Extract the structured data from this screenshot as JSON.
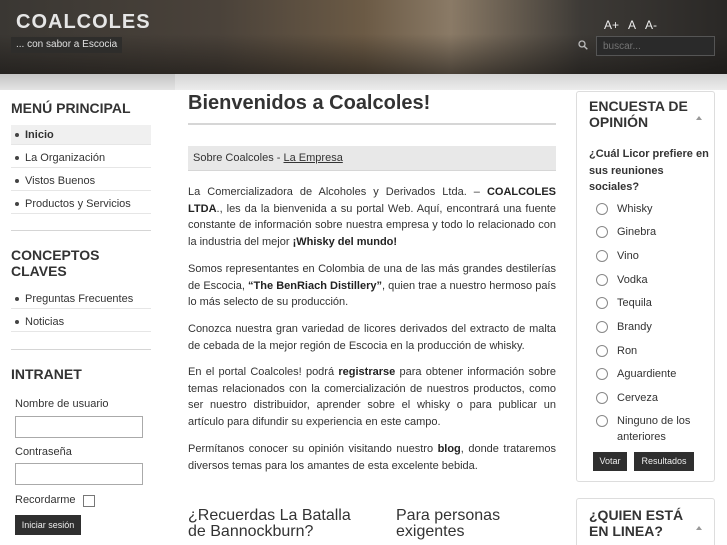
{
  "header": {
    "site_title": "COALCOLES",
    "slogan": "... con sabor a Escocia",
    "font_controls": [
      "A+",
      "A",
      "A-"
    ],
    "search_placeholder": "buscar..."
  },
  "left": {
    "main_menu": {
      "title": "MENÚ PRINCIPAL",
      "items": [
        {
          "label": "Inicio",
          "active": true
        },
        {
          "label": "La Organización"
        },
        {
          "label": "Vistos Buenos"
        },
        {
          "label": "Productos y Servicios"
        }
      ]
    },
    "concepts": {
      "title_line1": "CONCEPTOS",
      "title_line2": "CLAVES",
      "items": [
        {
          "label": "Preguntas Frecuentes"
        },
        {
          "label": "Noticias"
        }
      ]
    },
    "intranet": {
      "title": "INTRANET",
      "username_label": "Nombre de usuario",
      "password_label": "Contraseña",
      "remember_label": "Recordarme",
      "login_button": "Iniciar sesión"
    }
  },
  "main": {
    "title": "Bienvenidos a Coalcoles!",
    "breadcrumb": {
      "prefix": "Sobre Coalcoles - ",
      "link": "La Empresa"
    },
    "p1": {
      "a": "La Comercializadora de Alcoholes y Derivados Ltda. – ",
      "b": "COALCOLES LTDA",
      "c": "., les da la bienvenida a su portal Web. Aquí, encontrará una fuente constante de información sobre nuestra empresa y todo lo relacionado con la industria del mejor ",
      "d": "¡Whisky del mundo!"
    },
    "p2": {
      "a": "Somos representantes en Colombia de una de las más grandes destilerías de Escocia, ",
      "b": "“The BenRiach Distillery”",
      "c": ", quien trae a nuestro hermoso país lo más selecto de su producción."
    },
    "p3": "Conozca nuestra gran variedad de licores derivados del extracto de malta de cebada de la mejor región de Escocia en la producción de whisky.",
    "p4": {
      "a": "En el portal Coalcoles! podrá ",
      "b": "registrarse",
      "c": " para obtener información sobre temas relacionados con la comercialización de nuestros productos, como ser nuestro distribuidor, aprender sobre el whisky o para publicar un artículo para difundir su experiencia en este campo."
    },
    "p5": {
      "a": "Permítanos conocer su opinión visitando nuestro ",
      "b": "blog",
      "c": ", donde trataremos diversos temas para los amantes de esta excelente bebida."
    },
    "sub1_line1": "¿Recuerdas La Batalla",
    "sub1_line2": "de Bannockburn?",
    "sub2_line1": "Para personas",
    "sub2_line2": "exigentes"
  },
  "right": {
    "poll": {
      "title_line1": "ENCUESTA DE",
      "title_line2": "OPINIÓN",
      "question": "¿Cuál Licor prefiere en sus reuniones sociales?",
      "options": [
        "Whisky",
        "Ginebra",
        "Vino",
        "Vodka",
        "Tequila",
        "Brandy",
        "Ron",
        "Aguardiente",
        "Cerveza",
        "Ninguno de los anteriores"
      ],
      "vote_button": "Votar",
      "results_button": "Resultados"
    },
    "online": {
      "title_line1": "¿QUIEN ESTÁ",
      "title_line2": "EN LINEA?"
    }
  }
}
